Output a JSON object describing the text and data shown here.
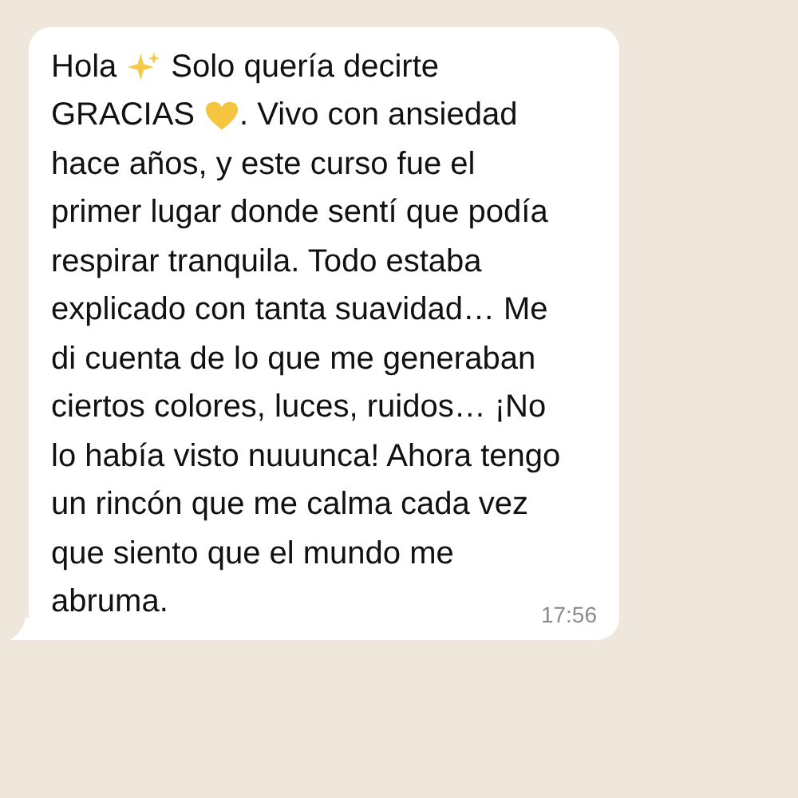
{
  "message": {
    "lines": [
      [
        {
          "kind": "text",
          "text": "Hola"
        },
        {
          "kind": "sparkles"
        },
        {
          "kind": "text",
          "text": "Solo quería decirte"
        }
      ],
      [
        {
          "kind": "text",
          "text": "GRACIAS"
        },
        {
          "kind": "heart"
        },
        {
          "kind": "text",
          "text": ". Vivo con ansiedad"
        }
      ],
      [
        {
          "kind": "text",
          "text": "hace años, y este curso fue el"
        }
      ],
      [
        {
          "kind": "text",
          "text": "primer lugar donde sentí que podía"
        }
      ],
      [
        {
          "kind": "text",
          "text": "respirar tranquila. Todo estaba"
        }
      ],
      [
        {
          "kind": "text",
          "text": "explicado con tanta suavidad… Me"
        }
      ],
      [
        {
          "kind": "text",
          "text": "di cuenta de lo que me generaban"
        }
      ],
      [
        {
          "kind": "text",
          "text": "ciertos colores, luces, ruidos… ¡No"
        }
      ],
      [
        {
          "kind": "text",
          "text": "lo había visto nuuunca! Ahora tengo"
        }
      ],
      [
        {
          "kind": "text",
          "text": "un rincón que me calma cada vez"
        }
      ],
      [
        {
          "kind": "text",
          "text": "que siento que el mundo me"
        }
      ],
      [
        {
          "kind": "text",
          "text": "abruma."
        }
      ]
    ],
    "time": "17:56"
  }
}
